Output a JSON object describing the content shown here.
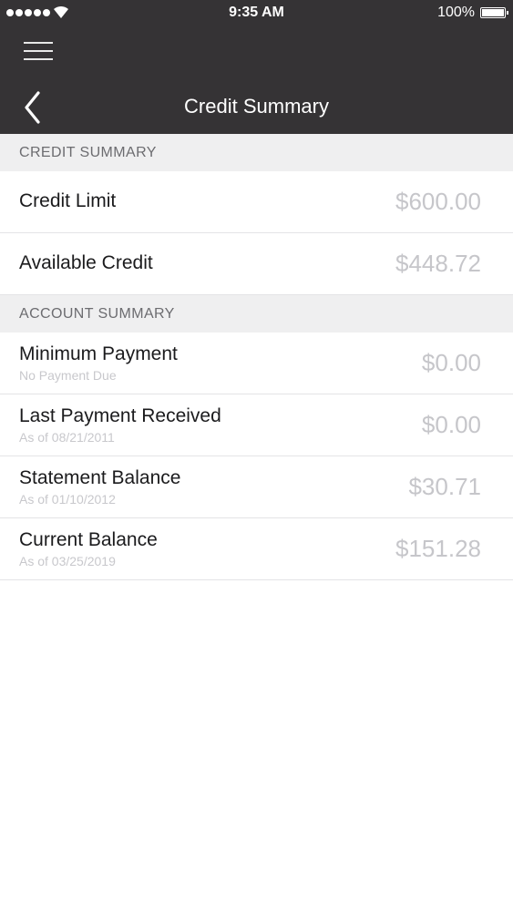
{
  "status_bar": {
    "time": "9:35 AM",
    "battery": "100%",
    "icons": [
      "signal-dots-icon",
      "wifi-icon",
      "battery-icon"
    ]
  },
  "nav": {
    "title": "Credit Summary",
    "menu_icon": "hamburger-icon",
    "back_icon": "chevron-left-icon"
  },
  "credit_summary": {
    "header": "CREDIT SUMMARY",
    "rows": [
      {
        "label": "Credit Limit",
        "value": "$600.00"
      },
      {
        "label": "Available Credit",
        "value": "$448.72"
      }
    ]
  },
  "account_summary": {
    "header": "ACCOUNT SUMMARY",
    "rows": [
      {
        "label": "Minimum Payment",
        "sublabel": "No Payment Due",
        "value": "$0.00"
      },
      {
        "label": "Last Payment Received",
        "sublabel": "As of 08/21/2011",
        "value": "$0.00"
      },
      {
        "label": "Statement Balance",
        "sublabel": "As of 01/10/2012",
        "value": "$30.71"
      },
      {
        "label": "Current Balance",
        "sublabel": "As of 03/25/2019",
        "value": "$151.28"
      }
    ]
  },
  "colors": {
    "nav_background": "#353335",
    "section_background": "#efeff0",
    "value_text": "#c6c6ca"
  }
}
